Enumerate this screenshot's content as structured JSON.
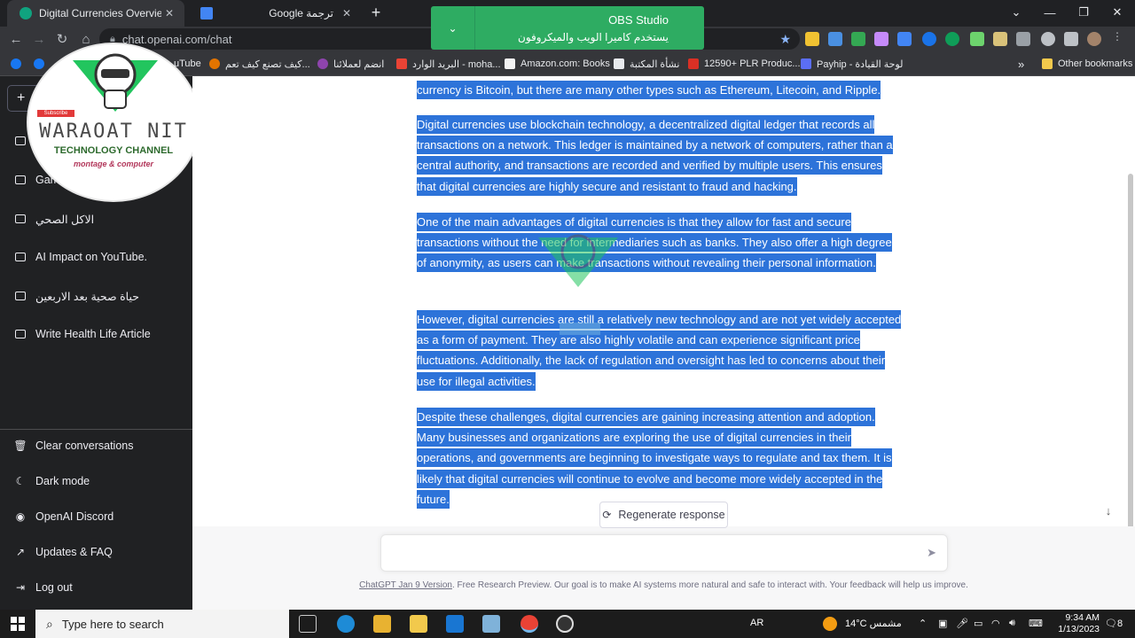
{
  "browser": {
    "tabs": [
      {
        "title": "Digital Currencies Overview",
        "active": true
      },
      {
        "title": "Google ترجمة",
        "active": false
      }
    ],
    "new_tab": "+",
    "window_controls": [
      "⌄",
      "—",
      "❐",
      "✕"
    ],
    "url": "chat.openai.com/chat",
    "bookmarks": [
      "uTube",
      "كيف تصنع كيف تعم...",
      "انضم لعملائنا",
      "البريد الوارد - moha...",
      "Amazon.com: Books",
      "نشأة المكتبة",
      "12590+ PLR Produc...",
      "Payhip - لوحة القيادة"
    ],
    "bookmarks_more": "»",
    "other_bookmarks": "Other bookmarks"
  },
  "obs": {
    "title": "OBS Studio",
    "message": "يستخدم كاميرا الويب والميكروفون"
  },
  "logo": {
    "name": "WARAOAT NIT",
    "subtitle": "TECHNOLOGY CHANNEL",
    "tagline": "montage & computer",
    "yt_label": "Subscribe"
  },
  "sidebar": {
    "new_chat": "+",
    "conversations": [
      {
        "label": ""
      },
      {
        "label": "Gam"
      },
      {
        "label": "الاكل الصحي"
      },
      {
        "label": "AI Impact on YouTube."
      },
      {
        "label": "حياة صحية بعد الاربعين"
      },
      {
        "label": "Write Health Life Article"
      }
    ],
    "actions": [
      {
        "label": "Clear conversations",
        "icon": "trash-icon"
      },
      {
        "label": "Dark mode",
        "icon": "moon-icon"
      },
      {
        "label": "OpenAI Discord",
        "icon": "discord-icon"
      },
      {
        "label": "Updates & FAQ",
        "icon": "external-link-icon"
      },
      {
        "label": "Log out",
        "icon": "logout-icon"
      }
    ]
  },
  "chat": {
    "paragraphs": [
      "currency is Bitcoin, but there are many other types such as Ethereum, Litecoin, and Ripple.",
      "Digital currencies use blockchain technology, a decentralized digital ledger that records all transactions on a network. This ledger is maintained by a network of computers, rather than a central authority, and transactions are recorded and verified by multiple users. This ensures that digital currencies are highly secure and resistant to fraud and hacking.",
      "One of the main advantages of digital currencies is that they allow for fast and secure transactions without the need for intermediaries such as banks. They also offer a high degree of anonymity, as users can make transactions without revealing their personal information.",
      "However, digital currencies are still a relatively new technology and are not yet widely accepted as a form of payment. They are also highly volatile and can experience significant price fluctuations. Additionally, the lack of regulation and oversight has led to concerns about their use for illegal activities.",
      "Despite these challenges, digital currencies are gaining increasing attention and adoption. Many businesses and organizations are exploring the use of digital currencies in their operations, and governments are beginning to investigate ways to regulate and tax them. It is likely that digital currencies will continue to evolve and become more widely accepted in the future."
    ],
    "regenerate_label": "Regenerate response",
    "prompt_placeholder": "",
    "footer_version": "ChatGPT Jan 9 Version",
    "footer_text": ". Free Research Preview. Our goal is to make AI systems more natural and safe to interact with. Your feedback will help us improve."
  },
  "taskbar": {
    "search_placeholder": "Type here to search",
    "lang": "AR",
    "weather": "14°C مشمس",
    "time": "9:34 AM",
    "date": "1/13/2023",
    "notifications": "8"
  },
  "colors": {
    "selection": "#2d73d9",
    "sidebar_bg": "#202123",
    "obs_green": "#2eac62"
  }
}
